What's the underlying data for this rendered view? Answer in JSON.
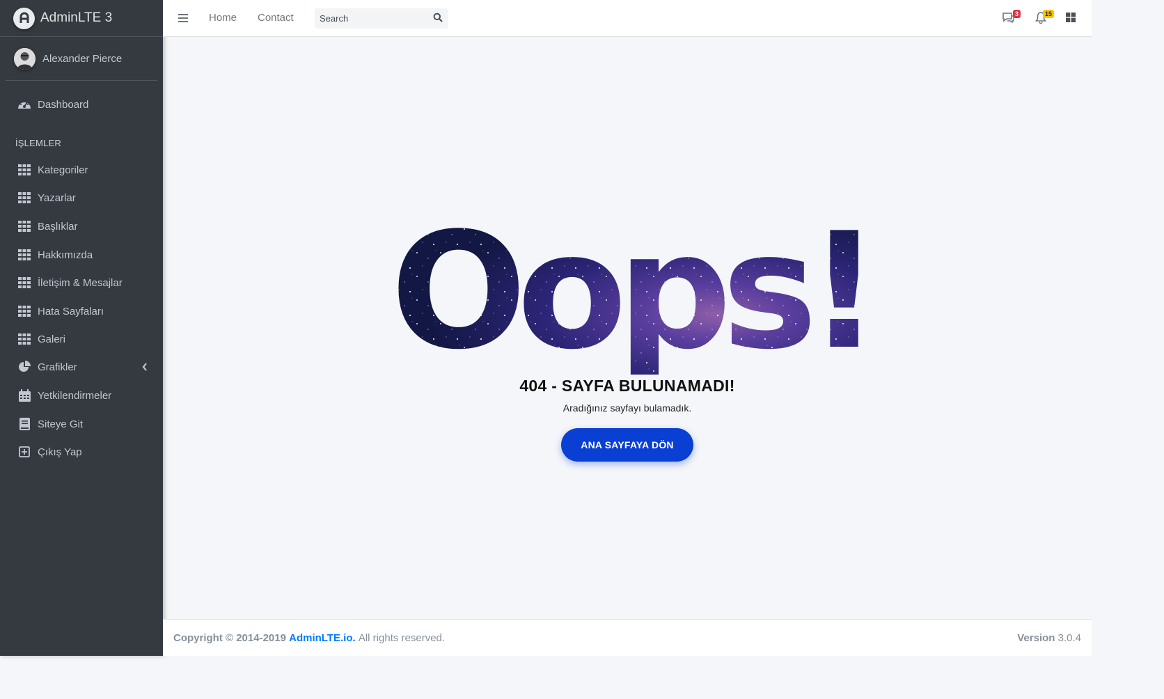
{
  "brand": {
    "name": "AdminLTE 3"
  },
  "user": {
    "name": "Alexander Pierce"
  },
  "sidebar": {
    "dashboard": "Dashboard",
    "section_header": "İŞLEMLER",
    "items": [
      {
        "label": "Kategoriler",
        "icon": "table-icon"
      },
      {
        "label": "Yazarlar",
        "icon": "table-icon"
      },
      {
        "label": "Başlıklar",
        "icon": "table-icon"
      },
      {
        "label": "Hakkımızda",
        "icon": "table-icon"
      },
      {
        "label": "İletişim & Mesajlar",
        "icon": "table-icon"
      },
      {
        "label": "Hata Sayfaları",
        "icon": "table-icon"
      },
      {
        "label": "Galeri",
        "icon": "table-icon"
      },
      {
        "label": "Grafikler",
        "icon": "pie-chart-icon"
      },
      {
        "label": "Yetkilendirmeler",
        "icon": "calendar-icon"
      },
      {
        "label": "Siteye Git",
        "icon": "book-icon"
      },
      {
        "label": "Çıkış Yap",
        "icon": "plus-square-icon"
      }
    ]
  },
  "navbar": {
    "home": "Home",
    "contact": "Contact",
    "search_placeholder": "Search",
    "messages_badge": "3",
    "notifications_badge": "15"
  },
  "error": {
    "headline": "Oops!",
    "title": "404 - SAYFA BULUNAMADI!",
    "subtitle": "Aradığınız sayfayı bulamadık.",
    "button": "ANA SAYFAYA DÖN"
  },
  "footer": {
    "copyright": "Copyright © 2014-2019",
    "link": "AdminLTE.io.",
    "rights": "All rights reserved.",
    "version_label": "Version",
    "version_value": "3.0.4"
  },
  "colors": {
    "sidebar_bg": "#343a40",
    "accent": "#007bff",
    "button_bg": "#0a3fd4",
    "badge_danger": "#dc3545",
    "badge_warning": "#ffc107"
  }
}
